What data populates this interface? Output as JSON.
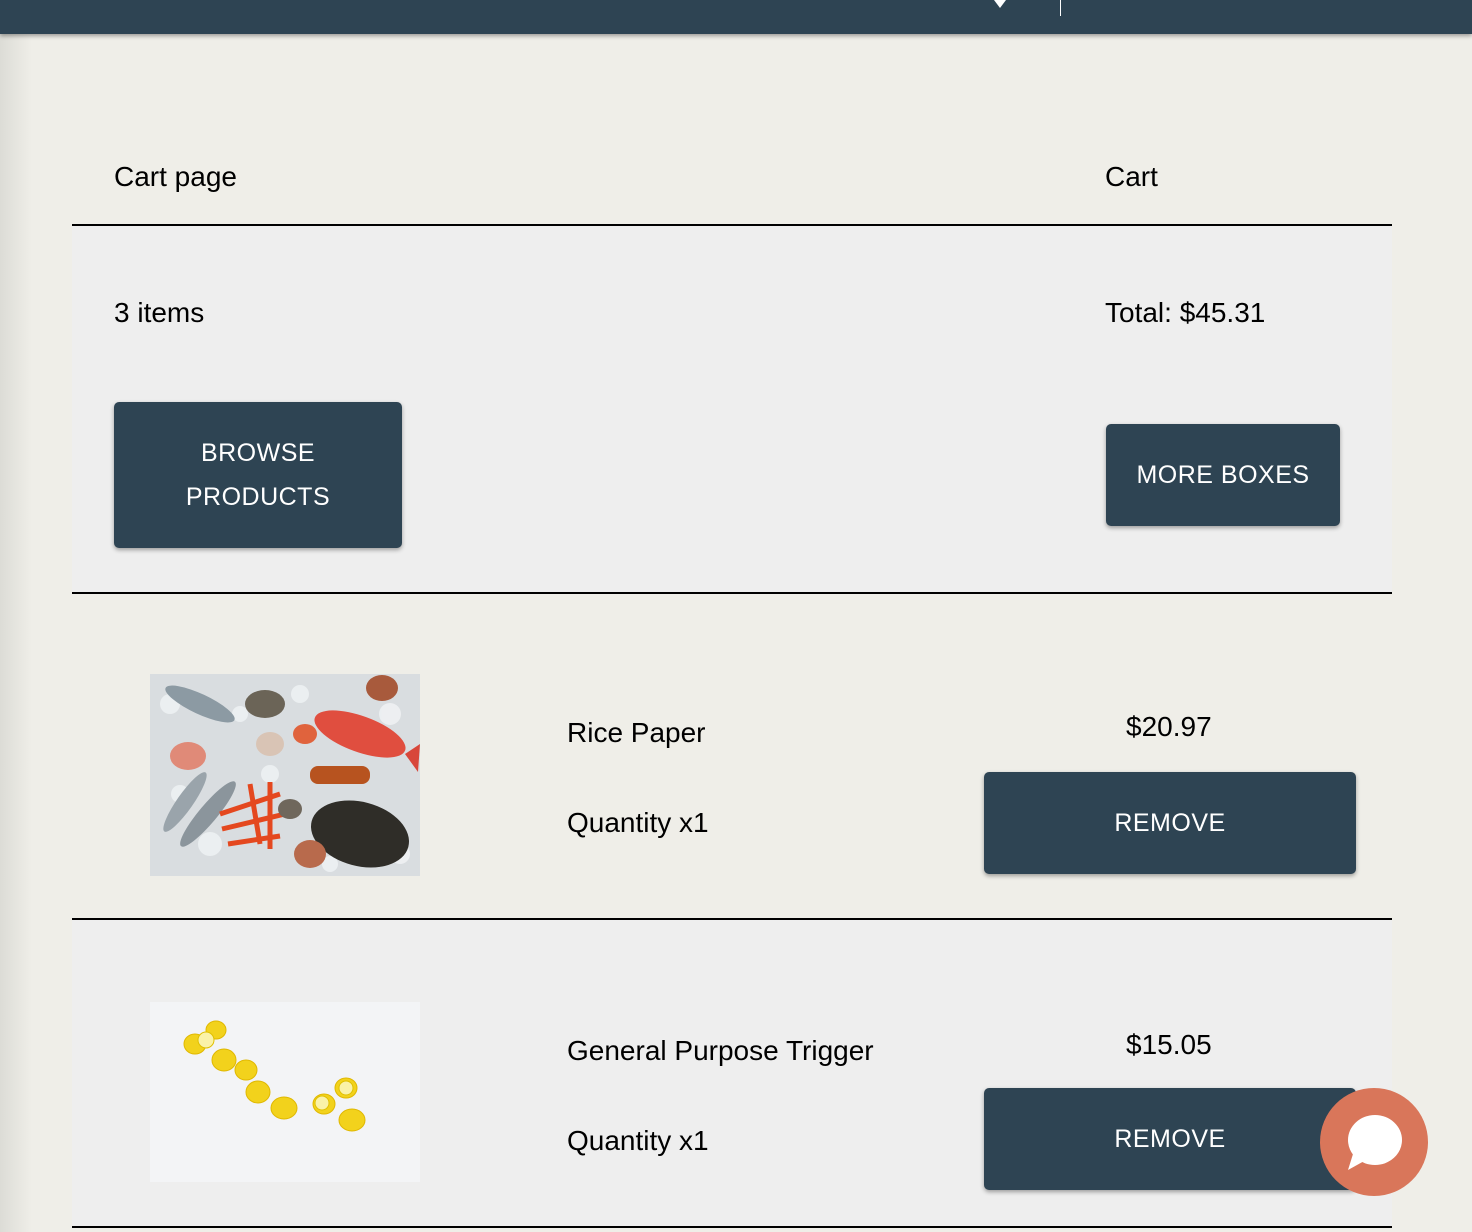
{
  "header": {
    "title": "Cart page",
    "cart_label": "Cart"
  },
  "summary": {
    "items_count": "3 items",
    "total": "Total: $45.31",
    "browse_label_line1": "BROWSE",
    "browse_label_line2": "PRODUCTS",
    "more_boxes_label": "MORE BOXES"
  },
  "items": [
    {
      "name": "Rice Paper",
      "quantity": "Quantity x1",
      "price": "$20.97",
      "remove_label": "REMOVE",
      "image": "seafood-on-ice-photo"
    },
    {
      "name": "General Purpose Trigger",
      "quantity": "Quantity x1",
      "price": "$15.05",
      "remove_label": "REMOVE",
      "image": "lemons-on-white-photo"
    }
  ],
  "colors": {
    "nav": "#2e4453",
    "button": "#2e4453",
    "chat": "#d9765a",
    "page_bg": "#efeee8",
    "panel_bg": "#eeeeee"
  },
  "chat": {
    "icon": "chat-bubble-icon"
  }
}
